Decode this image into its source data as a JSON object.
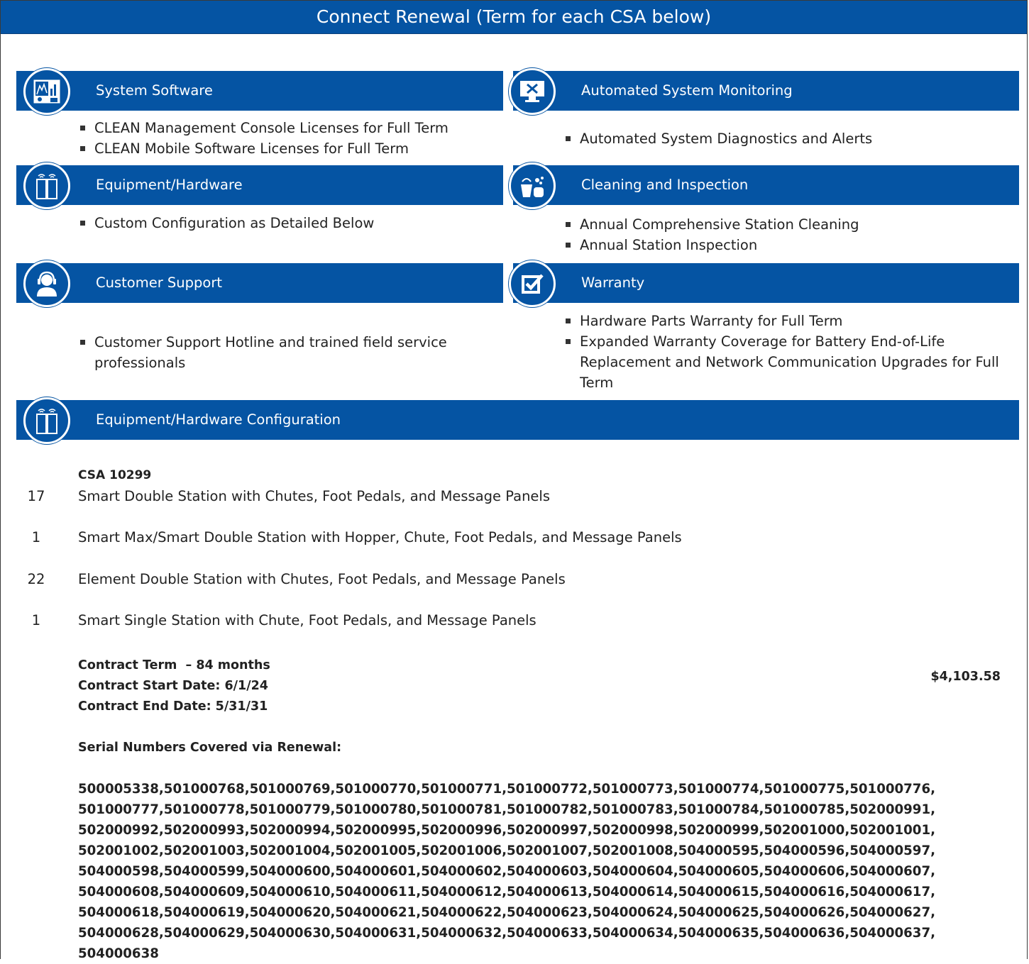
{
  "banner": {
    "title": "Connect Renewal (Term for each CSA below)"
  },
  "colors": {
    "brand_blue": "#0554a3",
    "text": "#222222"
  },
  "sections": [
    {
      "title": "System Software",
      "icon": "software-dashboard-icon",
      "bullets": [
        "CLEAN Management Console Licenses for Full Term",
        "CLEAN Mobile Software Licenses for Full Term"
      ]
    },
    {
      "title": "Automated System Monitoring",
      "icon": "monitor-tools-icon",
      "bullets": [
        "Automated System Diagnostics and Alerts"
      ]
    },
    {
      "title": "Equipment/Hardware",
      "icon": "station-cabinet-icon",
      "bullets": [
        "Custom Configuration as Detailed Below"
      ]
    },
    {
      "title": "Cleaning and Inspection",
      "icon": "cleaning-bucket-icon",
      "bullets": [
        "Annual Comprehensive Station Cleaning",
        "Annual Station Inspection"
      ]
    },
    {
      "title": "Customer Support",
      "icon": "headset-agent-icon",
      "bullets": [
        "Customer Support Hotline and trained field service professionals"
      ]
    },
    {
      "title": "Warranty",
      "icon": "checkbox-check-icon",
      "bullets": [
        "Hardware Parts Warranty for Full Term",
        "Expanded Warranty Coverage for Battery End-of-Life Replacement and Network Communication Upgrades for Full Term"
      ]
    },
    {
      "title": "Equipment/Hardware Configuration",
      "icon": "station-cabinet-icon"
    }
  ],
  "csa": {
    "title": "CSA 10299",
    "items": [
      {
        "qty": "17",
        "desc": "Smart Double Station with Chutes, Foot Pedals, and Message Panels"
      },
      {
        "qty": "1",
        "desc": "Smart Max/Smart Double Station with Hopper, Chute, Foot Pedals, and Message Panels"
      },
      {
        "qty": "22",
        "desc": "Element Double Station with Chutes, Foot Pedals, and Message Panels"
      },
      {
        "qty": "1",
        "desc": "Smart Single Station with Chute, Foot Pedals, and Message Panels"
      }
    ],
    "term": "Contract Term  – 84 months",
    "start": "Contract Start Date: 6/1/24",
    "end": "Contract End Date: 5/31/31",
    "price": "$4,103.58",
    "serials_heading": "Serial Numbers Covered via Renewal:",
    "serials": "500005338,501000768,501000769,501000770,501000771,501000772,501000773,501000774,501000775,501000776,\n501000777,501000778,501000779,501000780,501000781,501000782,501000783,501000784,501000785,502000991,\n502000992,502000993,502000994,502000995,502000996,502000997,502000998,502000999,502001000,502001001,\n502001002,502001003,502001004,502001005,502001006,502001007,502001008,504000595,504000596,504000597,\n504000598,504000599,504000600,504000601,504000602,504000603,504000604,504000605,504000606,504000607,\n504000608,504000609,504000610,504000611,504000612,504000613,504000614,504000615,504000616,504000617,\n504000618,504000619,504000620,504000621,504000622,504000623,504000624,504000625,504000626,504000627,\n504000628,504000629,504000630,504000631,504000632,504000633,504000634,504000635,504000636,504000637,\n504000638"
  }
}
